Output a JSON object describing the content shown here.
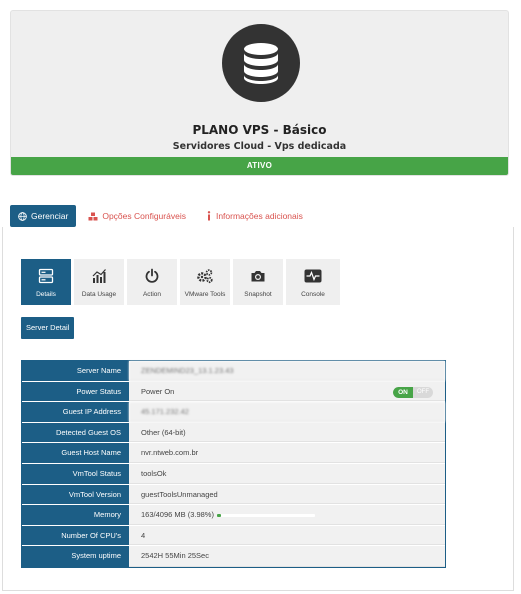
{
  "product": {
    "title": "PLANO VPS - Básico",
    "subtitle": "Servidores Cloud - Vps dedicada",
    "status": "ATIVO",
    "icon": "database-icon"
  },
  "tabs": [
    {
      "label": "Gerenciar",
      "icon": "globe-icon",
      "active": true
    },
    {
      "label": "Opções Configuráveis",
      "icon": "cubes-icon",
      "active": false
    },
    {
      "label": "Informações adicionais",
      "icon": "info-icon",
      "active": false
    }
  ],
  "toolbar": [
    {
      "label": "Details",
      "icon": "server-icon",
      "active": true
    },
    {
      "label": "Data Usage",
      "icon": "chart-icon",
      "active": false
    },
    {
      "label": "Action",
      "icon": "power-icon",
      "active": false
    },
    {
      "label": "VMware Tools",
      "icon": "gears-icon",
      "active": false
    },
    {
      "label": "Snapshot",
      "icon": "camera-icon",
      "active": false
    },
    {
      "label": "Console",
      "icon": "heartbeat-icon",
      "active": false
    }
  ],
  "server_detail_label": "Server Detail",
  "details": {
    "server_name": {
      "label": "Server Name",
      "value": "ZENDEMIND23_13.1.23.43"
    },
    "power_status": {
      "label": "Power Status",
      "value": "Power On",
      "toggle_on": "ON",
      "toggle_off": "OFF"
    },
    "guest_ip": {
      "label": "Guest IP Address",
      "value": "45.171.232.42"
    },
    "detected_os": {
      "label": "Detected Guest OS",
      "value": "Other (64-bit)"
    },
    "host_name": {
      "label": "Guest Host Name",
      "value": "nvr.ntweb.com.br"
    },
    "vmtool_status": {
      "label": "VmTool Status",
      "value": "toolsOk"
    },
    "vmtool_version": {
      "label": "VmTool Version",
      "value": "guestToolsUnmanaged"
    },
    "memory": {
      "label": "Memory",
      "value": "163/4096 MB (3.98%)",
      "usage_percent": 3.98
    },
    "cpus": {
      "label": "Number Of CPU's",
      "value": "4"
    },
    "uptime": {
      "label": "System uptime",
      "value": "2542H 55Min 25Sec"
    }
  },
  "colors": {
    "primary": "#1c5e86",
    "success": "#47a447",
    "danger": "#d9534f",
    "icon_dark": "#333333"
  }
}
